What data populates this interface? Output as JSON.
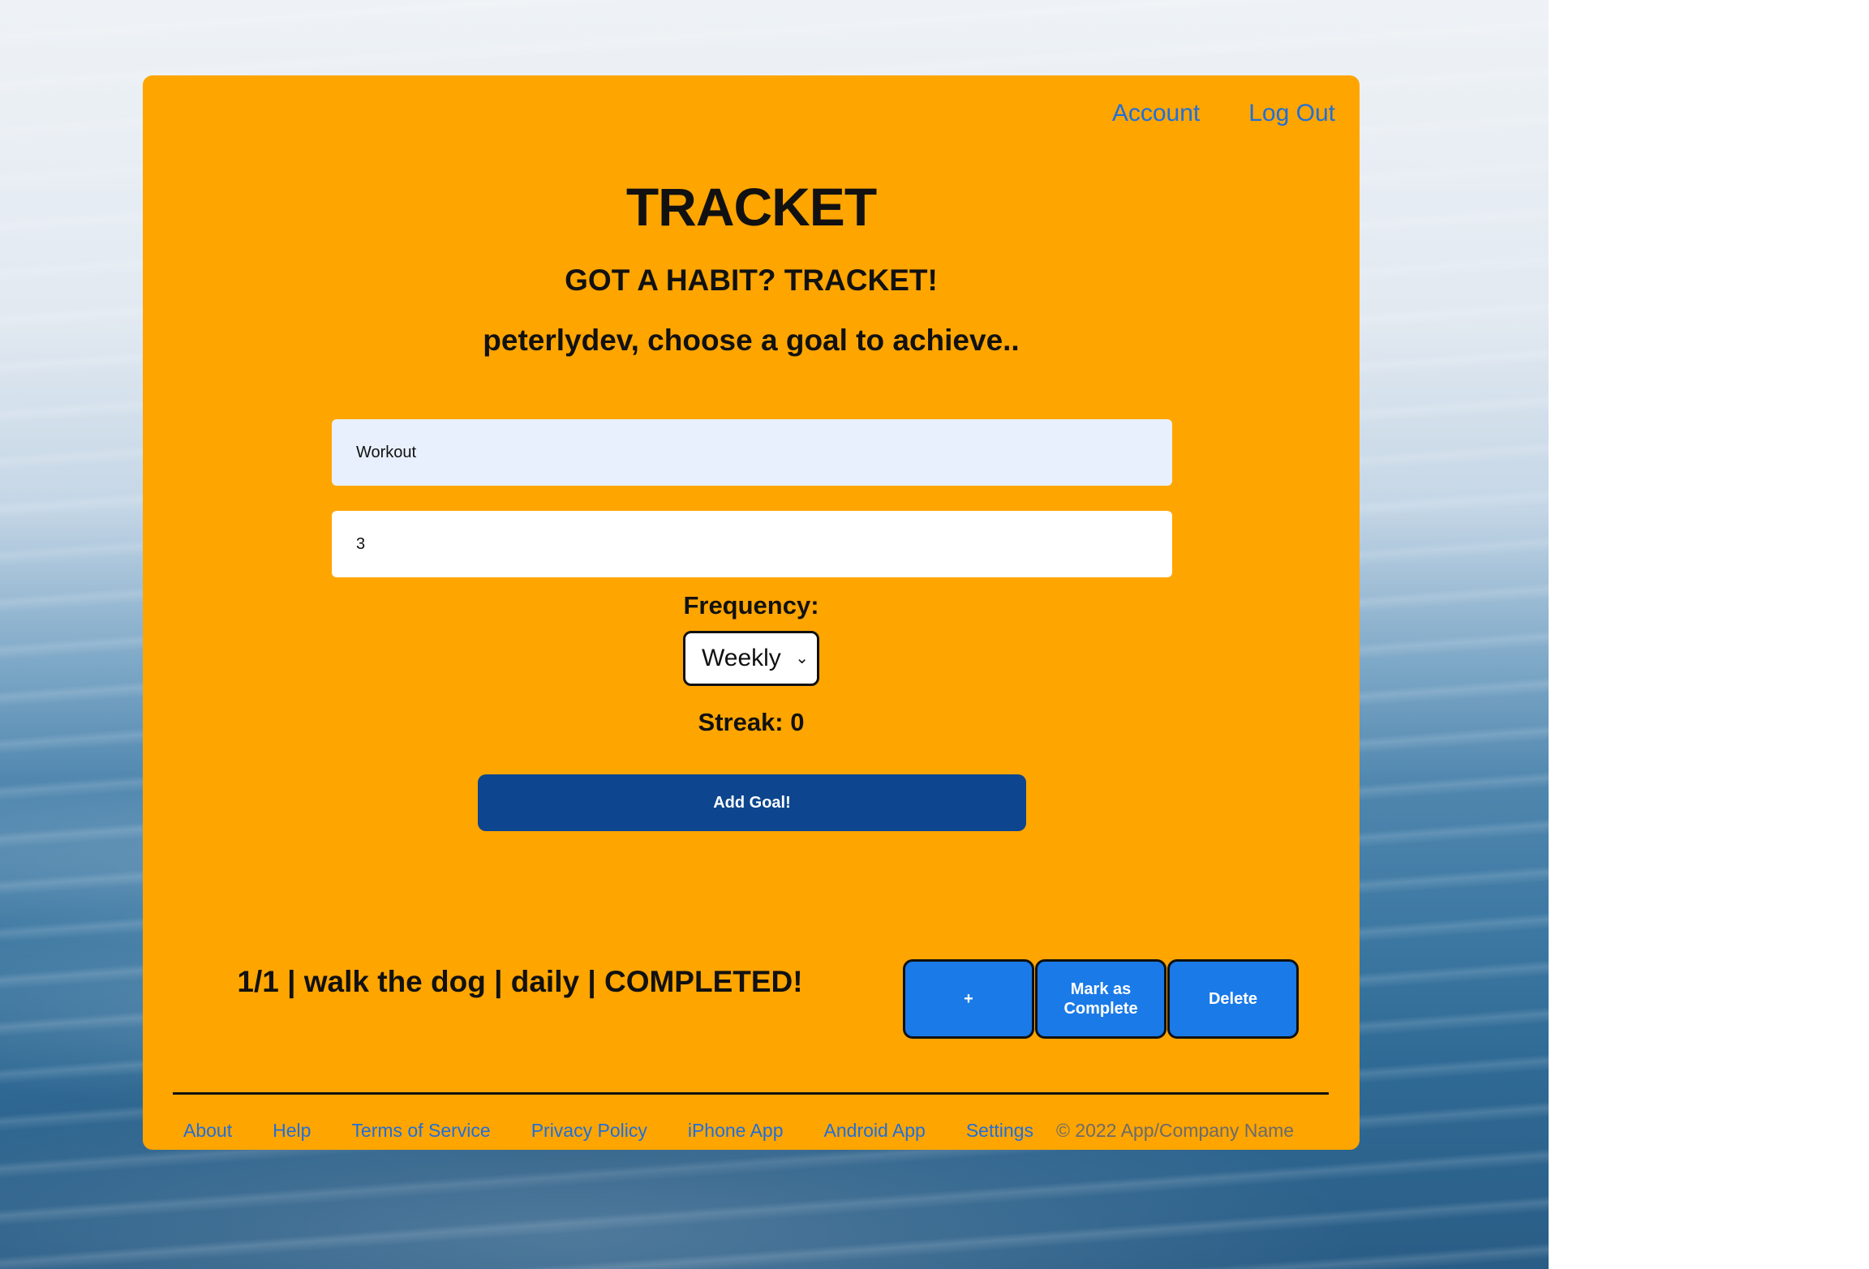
{
  "nav": {
    "account": "Account",
    "logout": "Log Out"
  },
  "header": {
    "title": "TRACKET",
    "subtitle": "GOT A HABIT? TRACKET!",
    "prompt": "peterlydev, choose a goal to achieve.."
  },
  "form": {
    "goal_value": "Workout",
    "amount_value": "3",
    "frequency_label": "Frequency:",
    "frequency_selected": "Weekly",
    "streak": "Streak: 0",
    "add_button": "Add Goal!"
  },
  "goals": [
    {
      "text": "1/1 | walk the dog | daily | COMPLETED!",
      "plus_label": "+",
      "complete_label": "Mark as Complete",
      "delete_label": "Delete"
    }
  ],
  "footer": {
    "links": [
      "About",
      "Help",
      "Terms of Service",
      "Privacy Policy",
      "iPhone App",
      "Android App",
      "Settings"
    ],
    "copyright": "© 2022 App/Company Name"
  },
  "colors": {
    "card": "#ffa500",
    "link": "#1e6fdc",
    "primary_button": "#0d468e",
    "row_button": "#1a7ae8"
  }
}
